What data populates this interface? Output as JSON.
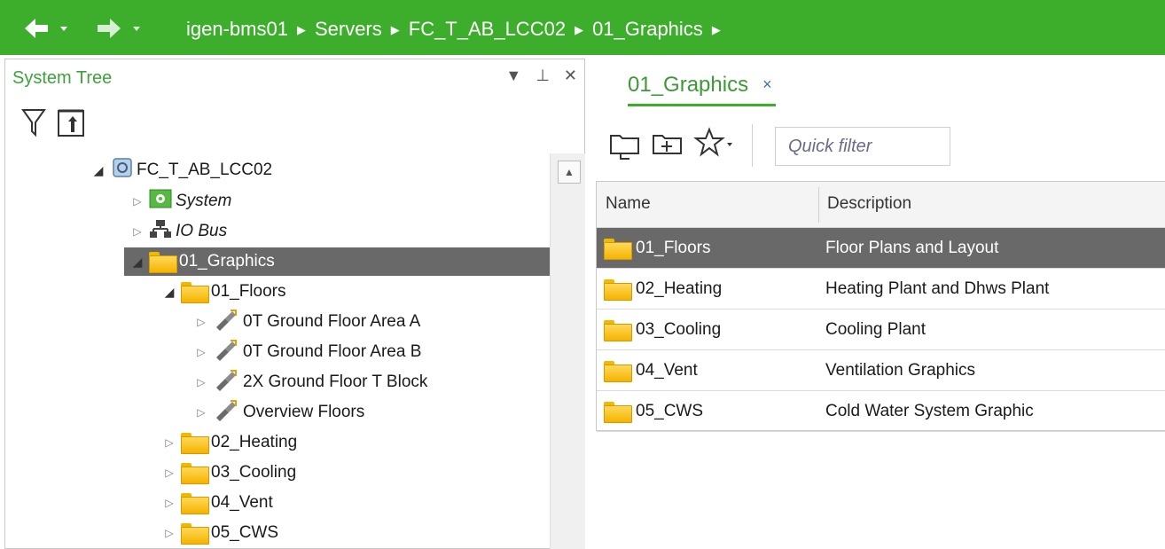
{
  "nav": {
    "back_icon": "back-arrow-icon",
    "forward_icon": "forward-arrow-icon",
    "breadcrumbs": [
      "igen-bms01",
      "Servers",
      "FC_T_AB_LCC02",
      "01_Graphics"
    ],
    "separator": "▶"
  },
  "tree_pane": {
    "title": "System Tree",
    "controls": [
      "▼",
      "⊥",
      "✕"
    ],
    "tools": [
      "filter-icon",
      "collapse-up-icon"
    ],
    "scroll_up": "▲",
    "items": [
      {
        "label": "FC_T_AB_LCC02",
        "expander": "◢",
        "icon": "server-icon"
      },
      {
        "label": "System",
        "expander": "▷",
        "icon": "system-gear-icon"
      },
      {
        "label": "IO Bus",
        "expander": "▷",
        "icon": "io-bus-icon"
      },
      {
        "label": "01_Graphics",
        "expander": "◢",
        "icon": "folder-icon"
      },
      {
        "label": "01_Floors",
        "expander": "◢",
        "icon": "folder-icon"
      },
      {
        "label": "0T Ground Floor Area A",
        "expander": "▷",
        "icon": "graphic-pen-icon"
      },
      {
        "label": "0T Ground Floor Area B",
        "expander": "▷",
        "icon": "graphic-pen-icon"
      },
      {
        "label": "2X Ground Floor T Block",
        "expander": "▷",
        "icon": "graphic-pen-icon"
      },
      {
        "label": "Overview Floors",
        "expander": "▷",
        "icon": "graphic-pen-icon"
      },
      {
        "label": "02_Heating",
        "expander": "▷",
        "icon": "folder-icon"
      },
      {
        "label": "03_Cooling",
        "expander": "▷",
        "icon": "folder-icon"
      },
      {
        "label": "04_Vent",
        "expander": "▷",
        "icon": "folder-icon"
      },
      {
        "label": "05_CWS",
        "expander": "▷",
        "icon": "folder-icon"
      }
    ]
  },
  "content": {
    "tab": {
      "label": "01_Graphics",
      "close": "×"
    },
    "tools": [
      "new-folder-icon",
      "add-item-icon",
      "favorites-star-icon"
    ],
    "quick_filter_placeholder": "Quick filter",
    "columns": {
      "name": "Name",
      "description": "Description"
    },
    "rows": [
      {
        "name": "01_Floors",
        "description": "Floor Plans and Layout"
      },
      {
        "name": "02_Heating",
        "description": "Heating Plant and Dhws Plant"
      },
      {
        "name": "03_Cooling",
        "description": "Cooling Plant"
      },
      {
        "name": "04_Vent",
        "description": "Ventilation Graphics"
      },
      {
        "name": "05_CWS",
        "description": "Cold Water System Graphic"
      }
    ]
  },
  "colors": {
    "brand_green": "#3dae2b",
    "selection": "#696969",
    "folder": "#f4b400"
  }
}
